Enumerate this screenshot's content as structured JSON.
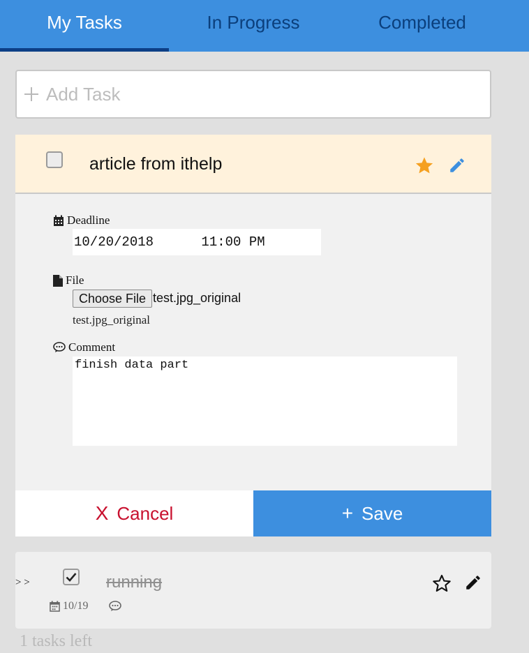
{
  "tabs": [
    {
      "label": "My Tasks",
      "active": true
    },
    {
      "label": "In Progress",
      "active": false
    },
    {
      "label": "Completed",
      "active": false
    }
  ],
  "add_task": {
    "placeholder": "Add Task",
    "icon": "plus-icon"
  },
  "open_task": {
    "title": "article from ithelp",
    "checked": false,
    "starred": true,
    "deadline_label": "Deadline",
    "deadline_value": "10/20/2018      11:00 PM",
    "file_label": "File",
    "file_button": "Choose File",
    "file_chosen": "test.jpg_original",
    "file_name": "test.jpg_original",
    "comment_label": "Comment",
    "comment_value": "finish data part",
    "cancel_label": "Cancel",
    "cancel_icon": "X",
    "save_label": "Save",
    "save_icon": "+"
  },
  "done_task": {
    "drag_label": "> >",
    "title": "running",
    "checked": true,
    "starred": false,
    "date": "10/19"
  },
  "footer": {
    "tasks_left": "1 tasks left"
  },
  "colors": {
    "accent": "#3d8fdf",
    "star": "#f5a020",
    "cancel": "#c8102e",
    "highlight": "#fff2dc"
  }
}
